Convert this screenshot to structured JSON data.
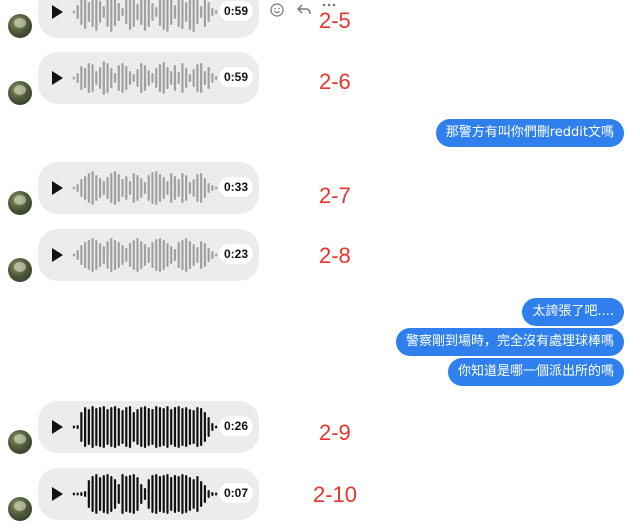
{
  "messages": [
    {
      "type": "audio",
      "duration": "0:59",
      "tag": "2-5",
      "wave": "light"
    },
    {
      "type": "audio",
      "duration": "0:59",
      "tag": "2-6",
      "wave": "light"
    },
    {
      "type": "text_out",
      "text": "那警方有叫你們刪reddit文嗎"
    },
    {
      "type": "audio",
      "duration": "0:33",
      "tag": "2-7",
      "wave": "light"
    },
    {
      "type": "audio",
      "duration": "0:23",
      "tag": "2-8",
      "wave": "light"
    },
    {
      "type": "text_out",
      "text": "太誇張了吧...."
    },
    {
      "type": "text_out",
      "text": "警察剛到場時，完全沒有處理球棒嗎"
    },
    {
      "type": "text_out",
      "text": "你知道是哪一個派出所的嗎"
    },
    {
      "type": "audio",
      "duration": "0:26",
      "tag": "2-9",
      "wave": "dark"
    },
    {
      "type": "audio",
      "duration": "0:07",
      "tag": "2-10",
      "wave": "dark"
    }
  ],
  "icons": {
    "play": "play-icon",
    "react": "smiley-icon",
    "reply": "reply-arrow-icon",
    "more": "more-dots-icon"
  },
  "colors": {
    "outgoing_bubble": "#2f80ed",
    "incoming_bubble": "#ececec",
    "tag_label": "#e8342c",
    "wave_light": "#a0a0a0",
    "wave_dark": "#111111"
  }
}
